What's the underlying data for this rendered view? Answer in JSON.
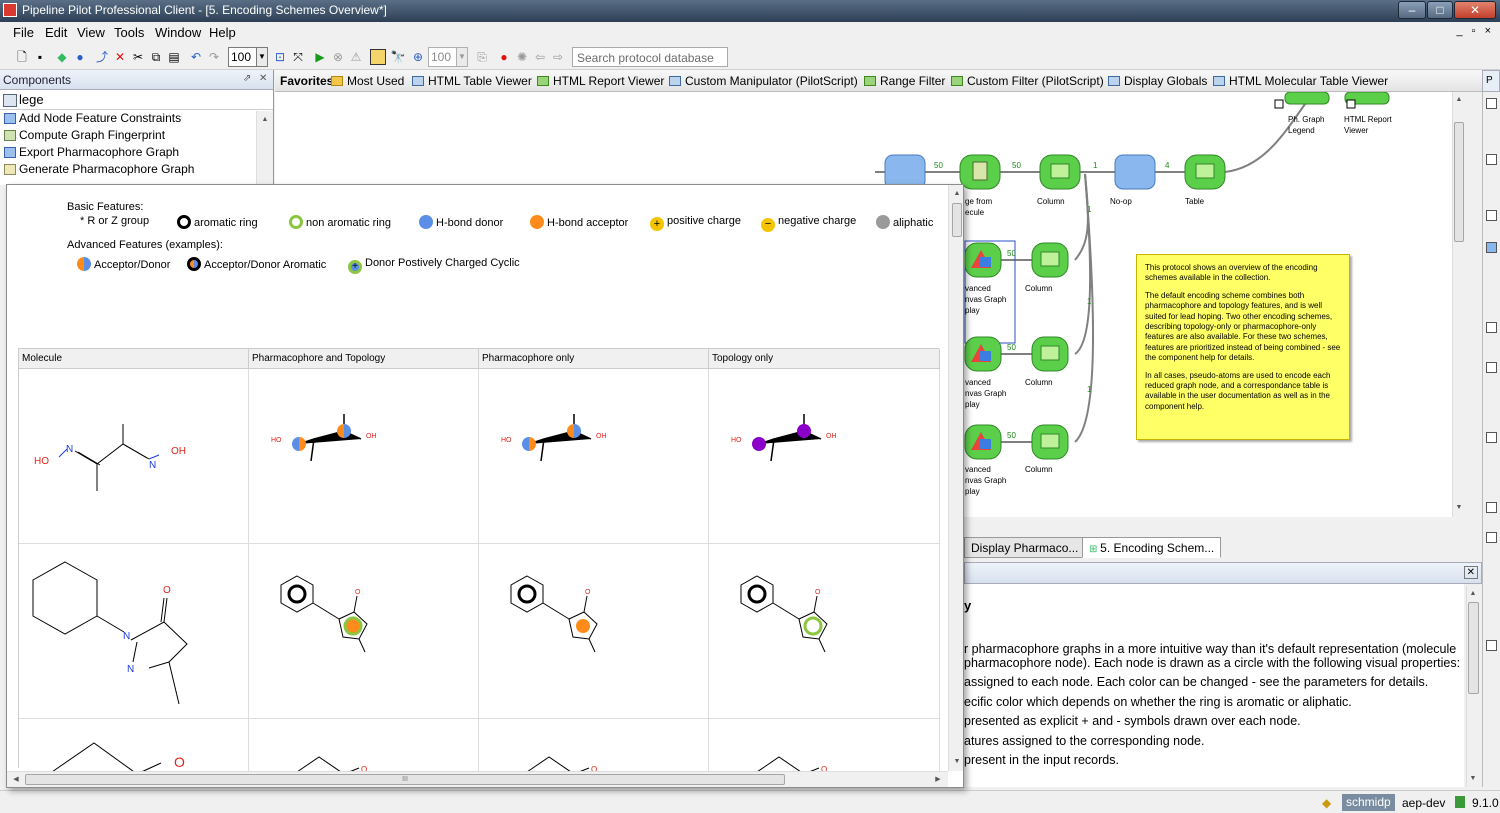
{
  "window": {
    "title": "Pipeline Pilot Professional Client - [5. Encoding Schemes Overview*]",
    "controls": [
      "–",
      "□",
      "✕"
    ]
  },
  "menu": {
    "items": [
      "File",
      "Edit",
      "View",
      "Tools",
      "Window",
      "Help"
    ],
    "mdi_controls": "_ ▫ ×"
  },
  "toolbar": {
    "zoom_value": "100",
    "zoom2_value": "100",
    "search_placeholder": "Search protocol database"
  },
  "components_panel": {
    "title": "Components",
    "search_value": "lege",
    "items": [
      "Add Node Feature Constraints",
      "Compute Graph Fingerprint",
      "Export Pharmacophore Graph",
      "Generate Pharmacophore Graph"
    ]
  },
  "favorites": {
    "label": "Favorites",
    "items": [
      "Most Used",
      "HTML Table Viewer",
      "HTML Report Viewer",
      "Custom Manipulator (PilotScript)",
      "Range Filter",
      "Custom Filter (PilotScript)",
      "Display Globals",
      "HTML Molecular Table Viewer"
    ],
    "side_tab": "P"
  },
  "canvas": {
    "node_labels": {
      "graph_legend": "Ph. Graph\nLegend",
      "html_report": "HTML Report\nViewer",
      "image_from_molecule": "ge from\necule",
      "column1": "Column",
      "noop": "No-op",
      "table": "Table",
      "adv1": "vanced\nnvas Graph\nplay",
      "column2": "Column",
      "adv2": "vanced\nnvas Graph\nplay",
      "column3": "Column",
      "adv3": "vanced\nnvas Graph\nplay",
      "column4": "Column"
    },
    "port_counts": [
      "50",
      "50",
      "1",
      "4",
      "50",
      "1",
      "50",
      "1",
      "50",
      "1"
    ],
    "sticky_note": [
      "This protocol shows an overview of the encoding schemes available in the collection.",
      "The default encoding scheme combines both pharmacophore and topology features, and is well suited for lead hoping. Two other encoding schemes, describing topology-only or pharmacophore-only features are also available. For these two schemes, features are prioritized instead of being combined - see the component help for details.",
      "In all cases, pseudo-atoms are used to encode each reduced graph node, and a correspondance table is available in the user documentation as well as in the component help."
    ]
  },
  "doc_tabs": [
    "Display Pharmaco...",
    "5. Encoding Schem..."
  ],
  "help": {
    "heading": "y",
    "lines": [
      "r pharmacophore graphs in a more intuitive way than it's default representation (molecule",
      "pharmacophore node). Each node is drawn as a circle with the following visual properties:",
      "assigned to each node. Each color can be changed - see the parameters for details.",
      "ecific color which depends on whether the ring is aromatic or aliphatic.",
      "presented as explicit + and - symbols drawn over each node.",
      "atures assigned to the corresponding node.",
      "present in the input records."
    ]
  },
  "status": {
    "user": "schmidp",
    "server": "aep-dev",
    "version": "9.1.0"
  },
  "viewer": {
    "basic_label": "Basic Features:",
    "basic_items": [
      {
        "label": "R or Z group",
        "icon": "star"
      },
      {
        "label": "aromatic ring",
        "icon": "black-ring"
      },
      {
        "label": "non aromatic ring",
        "icon": "green-ring"
      },
      {
        "label": "H-bond donor",
        "icon": "blue-dot"
      },
      {
        "label": "H-bond acceptor",
        "icon": "orange-dot"
      },
      {
        "label": "positive charge",
        "icon": "plus-dot"
      },
      {
        "label": "negative charge",
        "icon": "minus-dot"
      },
      {
        "label": "aliphatic",
        "icon": "grey-dot"
      }
    ],
    "advanced_label": "Advanced Features (examples):",
    "advanced_items": [
      {
        "label": "Acceptor/Donor",
        "icon": "split-dot"
      },
      {
        "label": "Acceptor/Donor Aromatic",
        "icon": "split-ring"
      },
      {
        "label": "Donor Postively Charged Cyclic",
        "icon": "plus-ring"
      }
    ],
    "columns": [
      "Molecule",
      "Pharmacophore and Topology",
      "Pharmacophore only",
      "Topology only"
    ],
    "atom_labels": {
      "ho": "HO",
      "oh": "OH",
      "n": "N",
      "o": "O"
    },
    "hscroll_marker": "III"
  },
  "colors": {
    "donor": "#5b8ee6",
    "acceptor": "#ff8c1a",
    "positive": "#f5c400",
    "aliphatic": "#9a9a9a",
    "nonaromatic": "#8cc63f",
    "topology": "#8a00c8",
    "node_green": "#5ccf4a",
    "sticky": "#ffff66"
  }
}
